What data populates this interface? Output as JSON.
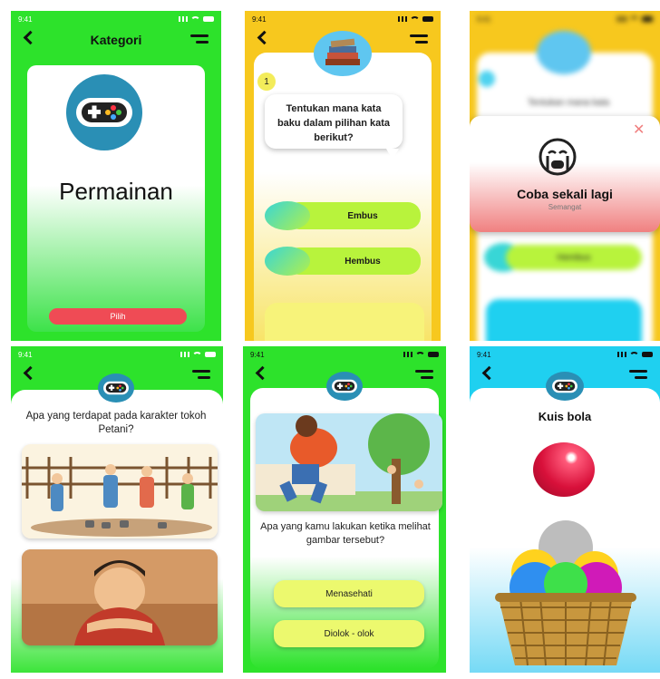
{
  "status_time": "9:41",
  "screen1": {
    "title": "Kategori",
    "category_label": "Permainan",
    "pick_button": "Pilih"
  },
  "screen2": {
    "question_number": "1",
    "question": "Tentukan mana kata baku dalam pilihan kata berikut?",
    "options": [
      "Embus",
      "Hembus"
    ]
  },
  "screen3": {
    "header_blur": "Tentukan mana kata",
    "popup_title": "Coba sekali lagi",
    "popup_subtitle": "Semangat",
    "option_blur": "Hembus",
    "close_icon": "close-icon"
  },
  "screen4": {
    "question": "Apa yang terdapat pada karakter tokoh Petani?"
  },
  "screen5": {
    "question": "Apa yang kamu lakukan ketika melihat gambar tersebut?",
    "options": [
      "Menasehati",
      "Diolok - olok"
    ]
  },
  "screen6": {
    "title": "Kuis bola"
  },
  "colors": {
    "green": "#2de22b",
    "yellow": "#f7c81e",
    "cyan": "#1fd0f0",
    "answer": "#ecf96e",
    "ball_red": "#d8103a"
  }
}
